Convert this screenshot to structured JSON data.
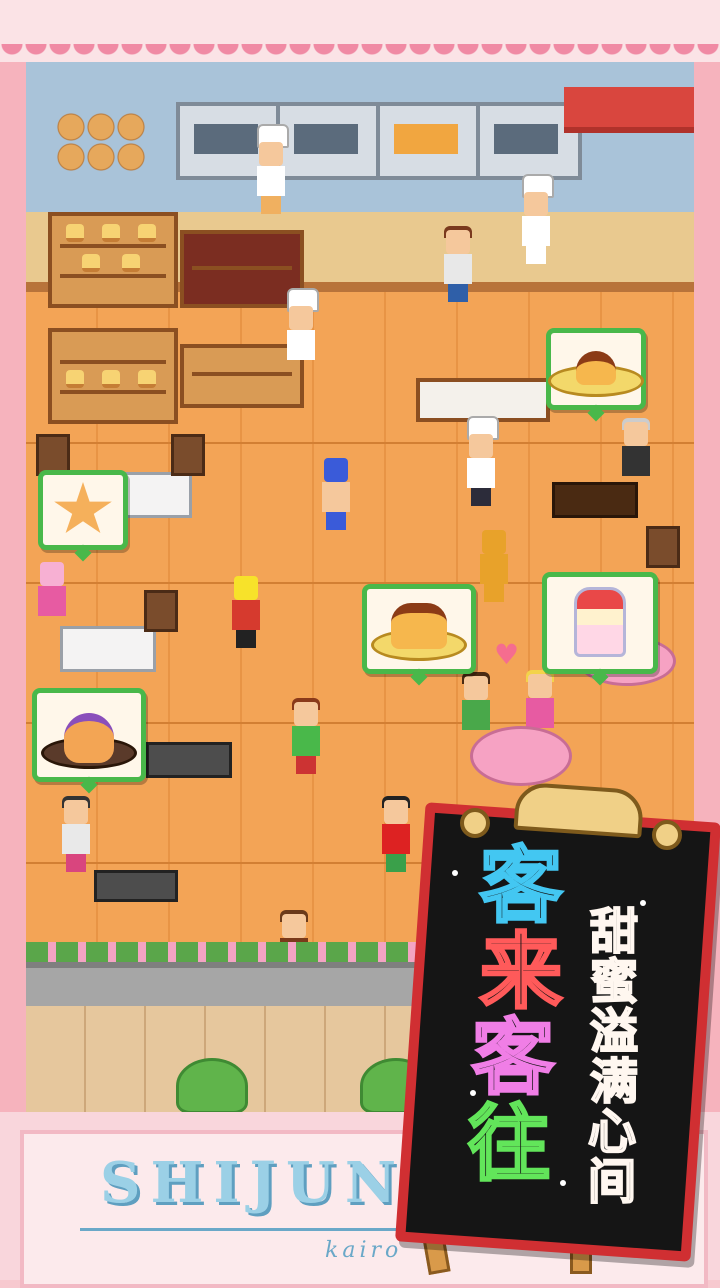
{
  "brand": {
    "title": "SHIJUN",
    "subtitle": "kairo"
  },
  "sign": {
    "headline": [
      "客",
      "来",
      "客",
      "往"
    ],
    "tagline": [
      "甜",
      "蜜",
      "溢",
      "满",
      "心",
      "间"
    ],
    "headline_colors": [
      "#43c7f2",
      "#ff5a5a",
      "#f07ee6",
      "#62e55a"
    ],
    "frame_color": "#d02f32"
  },
  "bubble_icons": [
    "pudding-dessert",
    "parfait-dessert",
    "cream-puff-dessert",
    "star-cookie-dessert",
    "plated-pudding-dessert"
  ],
  "colors": {
    "floor": "#f3a456",
    "frame_pink": "#f7c9cf",
    "bubble_border": "#49b84a"
  }
}
